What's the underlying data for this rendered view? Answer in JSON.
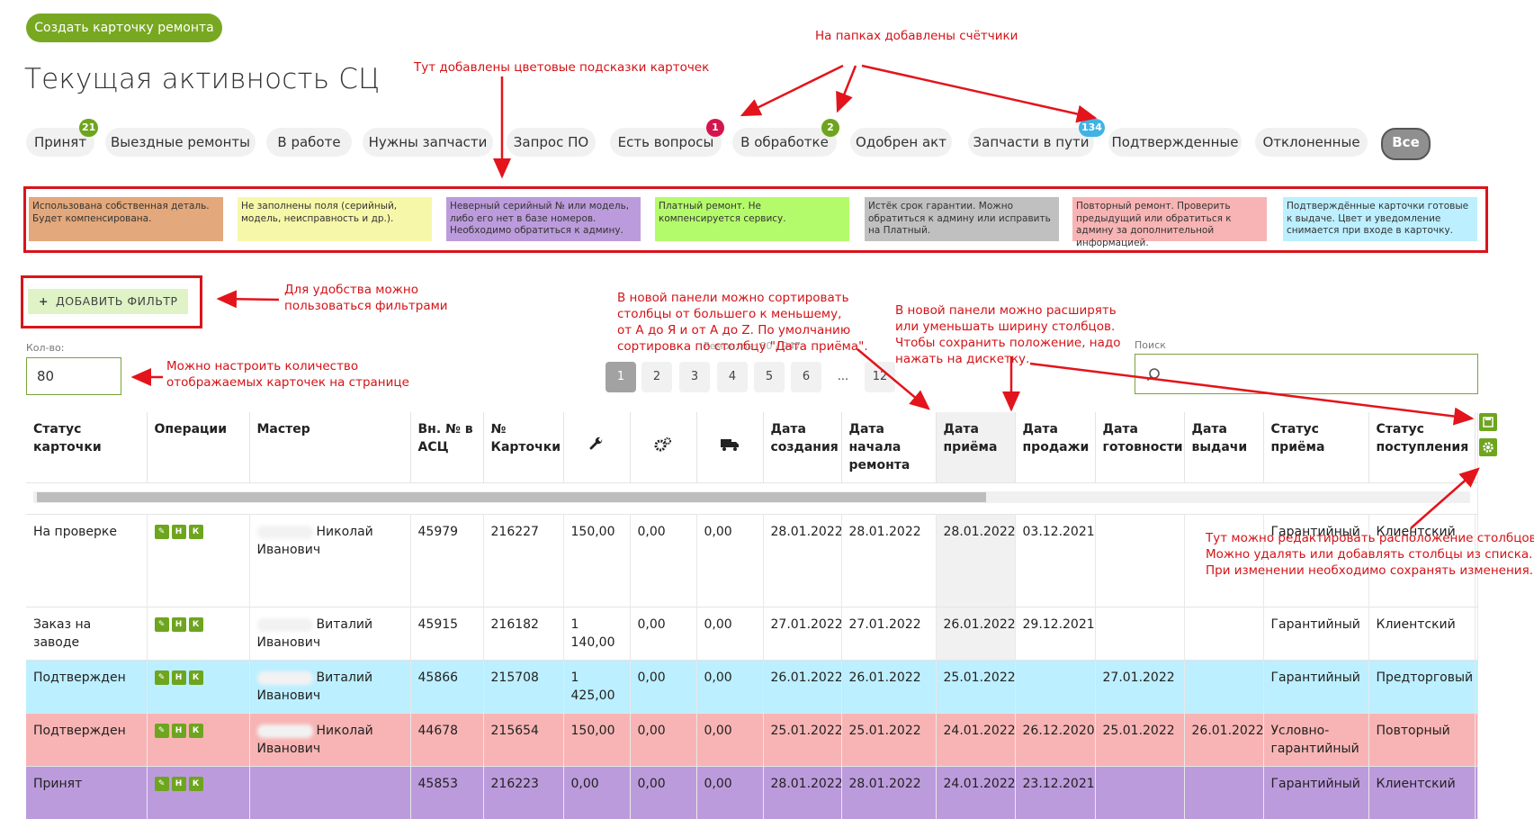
{
  "create_button": "Создать карточку ремонта",
  "title": "Текущая активность СЦ",
  "tabs": [
    {
      "label": "Принят",
      "badge": "21",
      "badge_color": "#6ea51e"
    },
    {
      "label": "Выездные ремонты"
    },
    {
      "label": "В работе"
    },
    {
      "label": "Нужны запчасти"
    },
    {
      "label": "Запрос ПО"
    },
    {
      "label": "Есть вопросы",
      "badge": "1",
      "badge_color": "#d5144e"
    },
    {
      "label": "В обработке",
      "badge": "2",
      "badge_color": "#6ea51e"
    },
    {
      "label": "Одобрен акт"
    },
    {
      "label": "Запчасти в пути",
      "badge": "134",
      "badge_color": "#40b3e6"
    },
    {
      "label": "Подтвержденные"
    },
    {
      "label": "Отклоненные"
    },
    {
      "label": "Все",
      "active": true
    }
  ],
  "legend": [
    {
      "text": "Использована собственная деталь. Будет компенсирована.",
      "color": "#e3a87b"
    },
    {
      "text": "Не заполнены поля (серийный, модель, неисправность и др.).",
      "color": "#f7f7a9"
    },
    {
      "text": "Неверный серийный № или модель, либо его нет в базе номеров. Необходимо обратиться к админу.",
      "color": "#bc9bdc"
    },
    {
      "text": "Платный ремонт. Не компенсируется сервису.",
      "color": "#b4fb6b"
    },
    {
      "text": "Истёк срок гарантии. Можно обратиться к админу или исправить на Платный.",
      "color": "#c0c0c0"
    },
    {
      "text": "Повторный ремонт. Проверить предыдущий или обратиться к админу за дополнительной информацией.",
      "color": "#f8b4b4"
    },
    {
      "text": "Подтверждённые карточки готовые к выдаче. Цвет и уведомление снимается при входе в карточку.",
      "color": "#bcefff"
    }
  ],
  "filter_button": "ДОБАВИТЬ ФИЛЬТР",
  "count_label": "Кол-во:",
  "count_value": "80",
  "search_label": "Поиск",
  "records_text": "Ремонтов: 80 / 947",
  "pages": [
    "1",
    "2",
    "3",
    "4",
    "5",
    "6",
    "...",
    "12"
  ],
  "annotations": {
    "counters": "На папках добавлены счётчики",
    "hints": "Тут добавлены цветовые подсказки карточек",
    "filters": "Для удобства можно\nпользоваться фильтрами",
    "count": "Можно настроить количество\nотображаемых карточек на странице",
    "sort": "В новой панели можно сортировать\nстолбцы от большего к меньшему,\nот А до Я и от А до Z. По умолчанию\nсортировка по столбцу \"Дата приёма\".",
    "width": "В новой панели можно расширять\nили уменьшать ширину столбцов.\nЧтобы сохранить положение, надо\nнажать на дискетку.",
    "columns": "Тут можно редактировать расположение столбцов.\nМожно удалять или добавлять столбцы из списка.\nПри изменении необходимо сохранять изменения."
  },
  "columns": [
    "Статус карточки",
    "Операции",
    "Мастер",
    "Вн. № в АСЦ",
    "№ Карточки",
    "wrench-icon",
    "gears-icon",
    "truck-icon",
    "Дата создания",
    "Дата начала ремонта",
    "Дата приёма",
    "Дата продажи",
    "Дата готовности",
    "Дата выдачи",
    "Статус приёма",
    "Статус поступления",
    ""
  ],
  "ops": [
    "✎",
    "Н",
    "К"
  ],
  "rows": [
    {
      "bg": "#ffffff",
      "cells": [
        "На проверке",
        "",
        "Николай Иванович",
        "45979",
        "216227",
        "150,00",
        "0,00",
        "0,00",
        "28.01.2022",
        "28.01.2022",
        "28.01.2022",
        "03.12.2021",
        "",
        "",
        "Гарантийный",
        "Клиентский",
        ""
      ]
    },
    {
      "bg": "#ffffff",
      "cells": [
        "Заказ на заводе",
        "",
        "Виталий Иванович",
        "45915",
        "216182",
        "1 140,00",
        "0,00",
        "0,00",
        "27.01.2022",
        "27.01.2022",
        "26.01.2022",
        "29.12.2021",
        "",
        "",
        "Гарантийный",
        "Клиентский",
        ""
      ]
    },
    {
      "bg": "#bcefff",
      "cells": [
        "Подтвержден",
        "",
        "Виталий Иванович",
        "45866",
        "215708",
        "1 425,00",
        "0,00",
        "0,00",
        "26.01.2022",
        "26.01.2022",
        "25.01.2022",
        "",
        "27.01.2022",
        "",
        "Гарантийный",
        "Предторговый",
        ""
      ]
    },
    {
      "bg": "#f8b4b4",
      "cells": [
        "Подтвержден",
        "",
        "Николай Иванович",
        "44678",
        "215654",
        "150,00",
        "0,00",
        "0,00",
        "25.01.2022",
        "25.01.2022",
        "24.01.2022",
        "26.12.2020",
        "25.01.2022",
        "26.01.2022",
        "Условно-гарантийный",
        "Повторный",
        ""
      ]
    },
    {
      "bg": "#bc9bdc",
      "cells": [
        "Принят",
        "",
        "",
        "45853",
        "216223",
        "0,00",
        "0,00",
        "0,00",
        "28.01.2022",
        "28.01.2022",
        "24.01.2022",
        "23.12.2021",
        "",
        "",
        "Гарантийный",
        "Клиентский",
        ""
      ]
    }
  ]
}
